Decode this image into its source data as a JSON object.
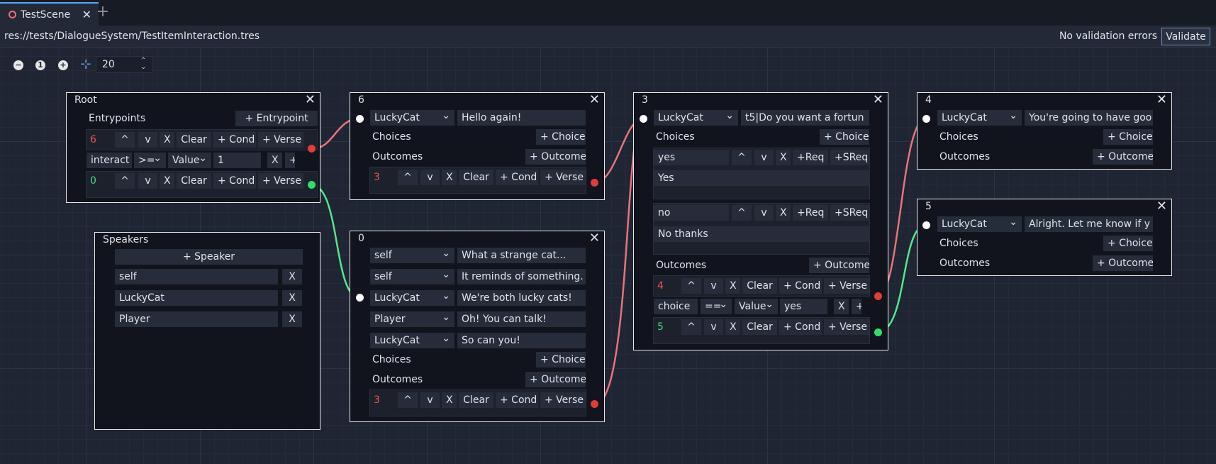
{
  "tab": {
    "title": "TestScene",
    "close": "✕",
    "add": "+"
  },
  "path": "res://tests/DialogueSystem/TestItemInteraction.tres",
  "validation_status": "No validation errors",
  "validate_label": "Validate",
  "toolbar": {
    "zoom_out": "−",
    "zoom_reset": "1",
    "zoom_in": "+",
    "snap_icon": "⊹",
    "snap_value": "20"
  },
  "colors": {
    "wire_red": "#e8737a",
    "wire_green": "#53e88b",
    "port_red": "#e23b3b",
    "port_green": "#2ede6e"
  },
  "root": {
    "title": "Root",
    "entrypoints_label": "Entrypoints",
    "add_entrypoint": "+ Entrypoint",
    "rows": [
      {
        "id": "6",
        "up": "^",
        "down": "v",
        "x": "X",
        "clear": "Clear",
        "cond": "+ Cond",
        "verse": "+ Verse"
      },
      {
        "id": "0",
        "up": "^",
        "down": "v",
        "x": "X",
        "clear": "Clear",
        "cond": "+ Cond",
        "verse": "+ Verse"
      }
    ],
    "condition": {
      "name": "interact",
      "op": ">=",
      "type": "Value",
      "value": "1",
      "x": "X",
      "plus": "+"
    }
  },
  "speakers": {
    "title": "Speakers",
    "add": "+ Speaker",
    "list": [
      "self",
      "LuckyCat",
      "Player"
    ],
    "remove": "X"
  },
  "node6": {
    "title": "6",
    "speaker": "LuckyCat",
    "text": "Hello again!",
    "choices": "Choices",
    "add_choice": "+ Choice",
    "outcomes": "Outcomes",
    "add_outcome": "+ Outcome",
    "outcome": {
      "id": "3",
      "up": "^",
      "down": "v",
      "x": "X",
      "clear": "Clear",
      "cond": "+ Cond",
      "verse": "+ Verse"
    }
  },
  "node0": {
    "title": "0",
    "lines": [
      {
        "speaker": "self",
        "text": "What a strange cat..."
      },
      {
        "speaker": "self",
        "text": "It reminds of something."
      },
      {
        "speaker": "LuckyCat",
        "text": "We're both lucky cats!"
      },
      {
        "speaker": "Player",
        "text": "Oh! You can talk!"
      },
      {
        "speaker": "LuckyCat",
        "text": "So can you!"
      }
    ],
    "choices": "Choices",
    "add_choice": "+ Choice",
    "outcomes": "Outcomes",
    "add_outcome": "+ Outcome",
    "outcome": {
      "id": "3",
      "up": "^",
      "down": "v",
      "x": "X",
      "clear": "Clear",
      "cond": "+ Cond",
      "verse": "+ Verse"
    }
  },
  "node3": {
    "title": "3",
    "speaker": "LuckyCat",
    "text": "t5|Do you want a fortun",
    "choices": "Choices",
    "add_choice": "+ Choice",
    "choice_list": [
      {
        "key": "yes",
        "text": "Yes"
      },
      {
        "key": "no",
        "text": "No thanks"
      }
    ],
    "choice_btns": {
      "up": "^",
      "down": "v",
      "x": "X",
      "req": "+Req",
      "sreq": "+SReq"
    },
    "outcomes": "Outcomes",
    "add_outcome": "+ Outcome",
    "outcome_rows": [
      {
        "id": "4",
        "up": "^",
        "down": "v",
        "x": "X",
        "clear": "Clear",
        "cond": "+ Cond",
        "verse": "+ Verse"
      },
      {
        "id": "5",
        "up": "^",
        "down": "v",
        "x": "X",
        "clear": "Clear",
        "cond": "+ Cond",
        "verse": "+ Verse"
      }
    ],
    "condition": {
      "name": "choice",
      "op": "==",
      "type": "Value",
      "value": "yes",
      "x": "X",
      "plus": "+"
    }
  },
  "node4": {
    "title": "4",
    "speaker": "LuckyCat",
    "text": "You're going to have goo",
    "choices": "Choices",
    "add_choice": "+ Choice",
    "outcomes": "Outcomes",
    "add_outcome": "+ Outcome"
  },
  "node5": {
    "title": "5",
    "speaker": "LuckyCat",
    "text": "Alright. Let me know if y",
    "choices": "Choices",
    "add_choice": "+ Choice",
    "outcomes": "Outcomes",
    "add_outcome": "+ Outcome"
  }
}
